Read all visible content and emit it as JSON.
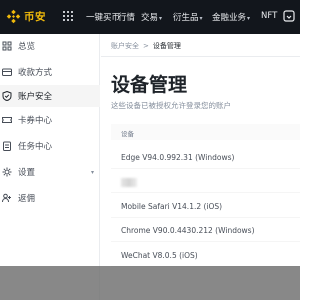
{
  "brand": {
    "name": "币安",
    "color": "#F0B90B"
  },
  "topnav": {
    "items": [
      {
        "label": "一键买币",
        "caret": false
      },
      {
        "label": "行情",
        "caret": false
      },
      {
        "label": "交易",
        "caret": true
      },
      {
        "label": "衍生品",
        "caret": true
      },
      {
        "label": "金融业务",
        "caret": true
      },
      {
        "label": "NFT",
        "caret": false
      }
    ],
    "caret_glyph": "▾"
  },
  "sidebar": {
    "items": [
      {
        "label": "总览",
        "icon": "overview-icon",
        "active": false
      },
      {
        "label": "收款方式",
        "icon": "payment-methods-icon",
        "active": false
      },
      {
        "label": "账户安全",
        "icon": "shield-icon",
        "active": true
      },
      {
        "label": "卡券中心",
        "icon": "ticket-icon",
        "active": false
      },
      {
        "label": "任务中心",
        "icon": "tasks-icon",
        "active": false
      },
      {
        "label": "设置",
        "icon": "gear-icon",
        "active": false,
        "expandable": true
      },
      {
        "label": "返佣",
        "icon": "referral-icon",
        "active": false
      }
    ],
    "caret_glyph": "▾"
  },
  "breadcrumb": {
    "parent": "账户安全",
    "separator": ">",
    "current": "设备管理"
  },
  "page": {
    "title": "设备管理",
    "subtitle": "这些设备已被授权允许登录您的账户"
  },
  "table": {
    "header": "设备",
    "rows": [
      {
        "device": "Edge V94.0.992.31 (Windows)",
        "redacted": false
      },
      {
        "device": "",
        "redacted": true
      },
      {
        "device": "Mobile Safari V14.1.2 (iOS)",
        "redacted": false
      },
      {
        "device": "Chrome V90.0.4430.212 (Windows)",
        "redacted": false
      },
      {
        "device": "WeChat V8.0.5 (iOS)",
        "redacted": false
      }
    ]
  }
}
